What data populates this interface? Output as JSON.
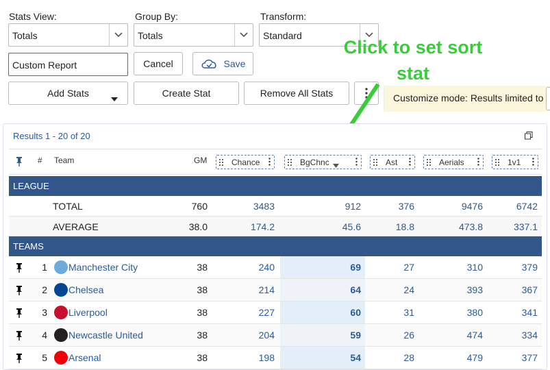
{
  "controls": {
    "stats_view_label": "Stats View:",
    "stats_view_value": "Totals",
    "group_by_label": "Group By:",
    "group_by_value": "Totals",
    "transform_label": "Transform:",
    "transform_value": "Standard",
    "report_name": "Custom Report",
    "cancel_label": "Cancel",
    "save_label": "Save",
    "add_stats_label": "Add Stats",
    "create_stat_label": "Create Stat",
    "remove_all_label": "Remove All Stats"
  },
  "callout": {
    "line1": "Click to set sort",
    "line2": "stat",
    "color": "#3bcc3b"
  },
  "banner": {
    "text": "Customize mode: Results limited to"
  },
  "results": {
    "summary": "Results 1 - 20 of 20",
    "columns": {
      "rank": "#",
      "team": "Team",
      "gm": "GM",
      "chance": "Chance",
      "bgchnc": "BgChnc",
      "ast": "Ast",
      "aerials": "Aerials",
      "v1": "1v1"
    },
    "league_label": "LEAGUE",
    "teams_label": "TEAMS",
    "league_rows": [
      {
        "name": "TOTAL",
        "gm": "760",
        "chance": "3483",
        "bgchnc": "912",
        "ast": "376",
        "aerials": "9476",
        "v1": "6742"
      },
      {
        "name": "AVERAGE",
        "gm": "38.0",
        "chance": "174.2",
        "bgchnc": "45.6",
        "ast": "18.8",
        "aerials": "473.8",
        "v1": "337.1"
      }
    ],
    "teams": [
      {
        "rank": "1",
        "name": "Manchester City",
        "gm": "38",
        "chance": "240",
        "bgchnc": "69",
        "ast": "27",
        "aerials": "310",
        "v1": "379",
        "badge": "#6cabdd"
      },
      {
        "rank": "2",
        "name": "Chelsea",
        "gm": "38",
        "chance": "214",
        "bgchnc": "64",
        "ast": "24",
        "aerials": "393",
        "v1": "367",
        "badge": "#034694"
      },
      {
        "rank": "3",
        "name": "Liverpool",
        "gm": "38",
        "chance": "227",
        "bgchnc": "60",
        "ast": "31",
        "aerials": "380",
        "v1": "341",
        "badge": "#c8102e"
      },
      {
        "rank": "4",
        "name": "Newcastle United",
        "gm": "38",
        "chance": "204",
        "bgchnc": "59",
        "ast": "26",
        "aerials": "474",
        "v1": "334",
        "badge": "#241f20"
      },
      {
        "rank": "5",
        "name": "Arsenal",
        "gm": "38",
        "chance": "198",
        "bgchnc": "54",
        "ast": "28",
        "aerials": "479",
        "v1": "377",
        "badge": "#ef0107"
      }
    ]
  },
  "colors": {
    "header_band": "#33568a",
    "link": "#2a5b9a",
    "sort_highlight": "#e3eef9"
  }
}
